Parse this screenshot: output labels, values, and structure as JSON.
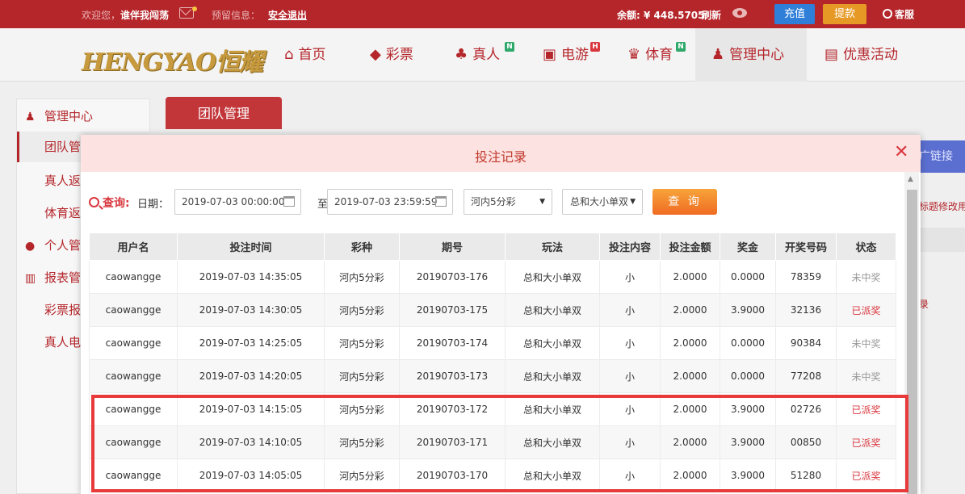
{
  "topbar": {
    "welcome": "欢迎您，",
    "username": "谁伴我闯荡",
    "notice": "预留信息：",
    "logout": "安全退出",
    "balance": "余额: ¥ 448.5705",
    "refresh": "刷新",
    "recharge": "充值",
    "withdraw": "提款",
    "service": "客服"
  },
  "nav": {
    "logo": "HENGYAO恒耀",
    "items": [
      {
        "label": "首页",
        "icon": "home-icon"
      },
      {
        "label": "彩票",
        "icon": "ticket-icon"
      },
      {
        "label": "真人",
        "icon": "dealer-icon",
        "badge": "N"
      },
      {
        "label": "电游",
        "icon": "slot-icon",
        "badge": "H"
      },
      {
        "label": "体育",
        "icon": "trophy-icon",
        "badge": "N"
      },
      {
        "label": "管理中心",
        "icon": "users-icon"
      },
      {
        "label": "优惠活动",
        "icon": "gift-icon"
      }
    ]
  },
  "sidebar": {
    "items": [
      {
        "label": "管理中心",
        "type": "head"
      },
      {
        "label": "团队管理",
        "type": "sub"
      },
      {
        "label": "真人返点",
        "type": "sub"
      },
      {
        "label": "体育返点",
        "type": "sub"
      },
      {
        "label": "个人管理",
        "type": "head"
      },
      {
        "label": "报表管理",
        "type": "head"
      },
      {
        "label": "彩票报表",
        "type": "sub"
      },
      {
        "label": "真人电游",
        "type": "sub"
      }
    ]
  },
  "main": {
    "tab": "团队管理",
    "promo_link": "广链接",
    "bg_text1": "标题修改用",
    "bg_text2": "录"
  },
  "modal": {
    "title": "投注记录",
    "close": "✕",
    "query_label": "查询:",
    "date_label": "日期：",
    "start_date": "2019-07-03 00:00:00",
    "to": "至",
    "end_date": "2019-07-03 23:59:59",
    "lottery_select": "河内5分彩",
    "play_select": "总和大小单双",
    "query_button": "查 询",
    "columns": [
      "用户名",
      "投注时间",
      "彩种",
      "期号",
      "玩法",
      "投注内容",
      "投注金额",
      "奖金",
      "开奖号码",
      "状态"
    ],
    "rows": [
      [
        "caowangge",
        "2019-07-03 14:35:05",
        "河内5分彩",
        "20190703-176",
        "总和大小单双",
        "小",
        "2.0000",
        "0.0000",
        "78359",
        "未中奖"
      ],
      [
        "caowangge",
        "2019-07-03 14:30:05",
        "河内5分彩",
        "20190703-175",
        "总和大小单双",
        "小",
        "2.0000",
        "3.9000",
        "32136",
        "已派奖"
      ],
      [
        "caowangge",
        "2019-07-03 14:25:05",
        "河内5分彩",
        "20190703-174",
        "总和大小单双",
        "小",
        "2.0000",
        "0.0000",
        "90384",
        "未中奖"
      ],
      [
        "caowangge",
        "2019-07-03 14:20:05",
        "河内5分彩",
        "20190703-173",
        "总和大小单双",
        "小",
        "2.0000",
        "0.0000",
        "77208",
        "未中奖"
      ],
      [
        "caowangge",
        "2019-07-03 14:15:05",
        "河内5分彩",
        "20190703-172",
        "总和大小单双",
        "小",
        "2.0000",
        "3.9000",
        "02726",
        "已派奖"
      ],
      [
        "caowangge",
        "2019-07-03 14:10:05",
        "河内5分彩",
        "20190703-171",
        "总和大小单双",
        "小",
        "2.0000",
        "3.9000",
        "00850",
        "已派奖"
      ],
      [
        "caowangge",
        "2019-07-03 14:05:05",
        "河内5分彩",
        "20190703-170",
        "总和大小单双",
        "小",
        "2.0000",
        "3.9000",
        "51280",
        "已派奖"
      ]
    ]
  },
  "colors": {
    "brand_red": "#b5262b",
    "win_red": "#d9363e",
    "lose_gray": "#999999",
    "highlight": "#e83a3a"
  }
}
